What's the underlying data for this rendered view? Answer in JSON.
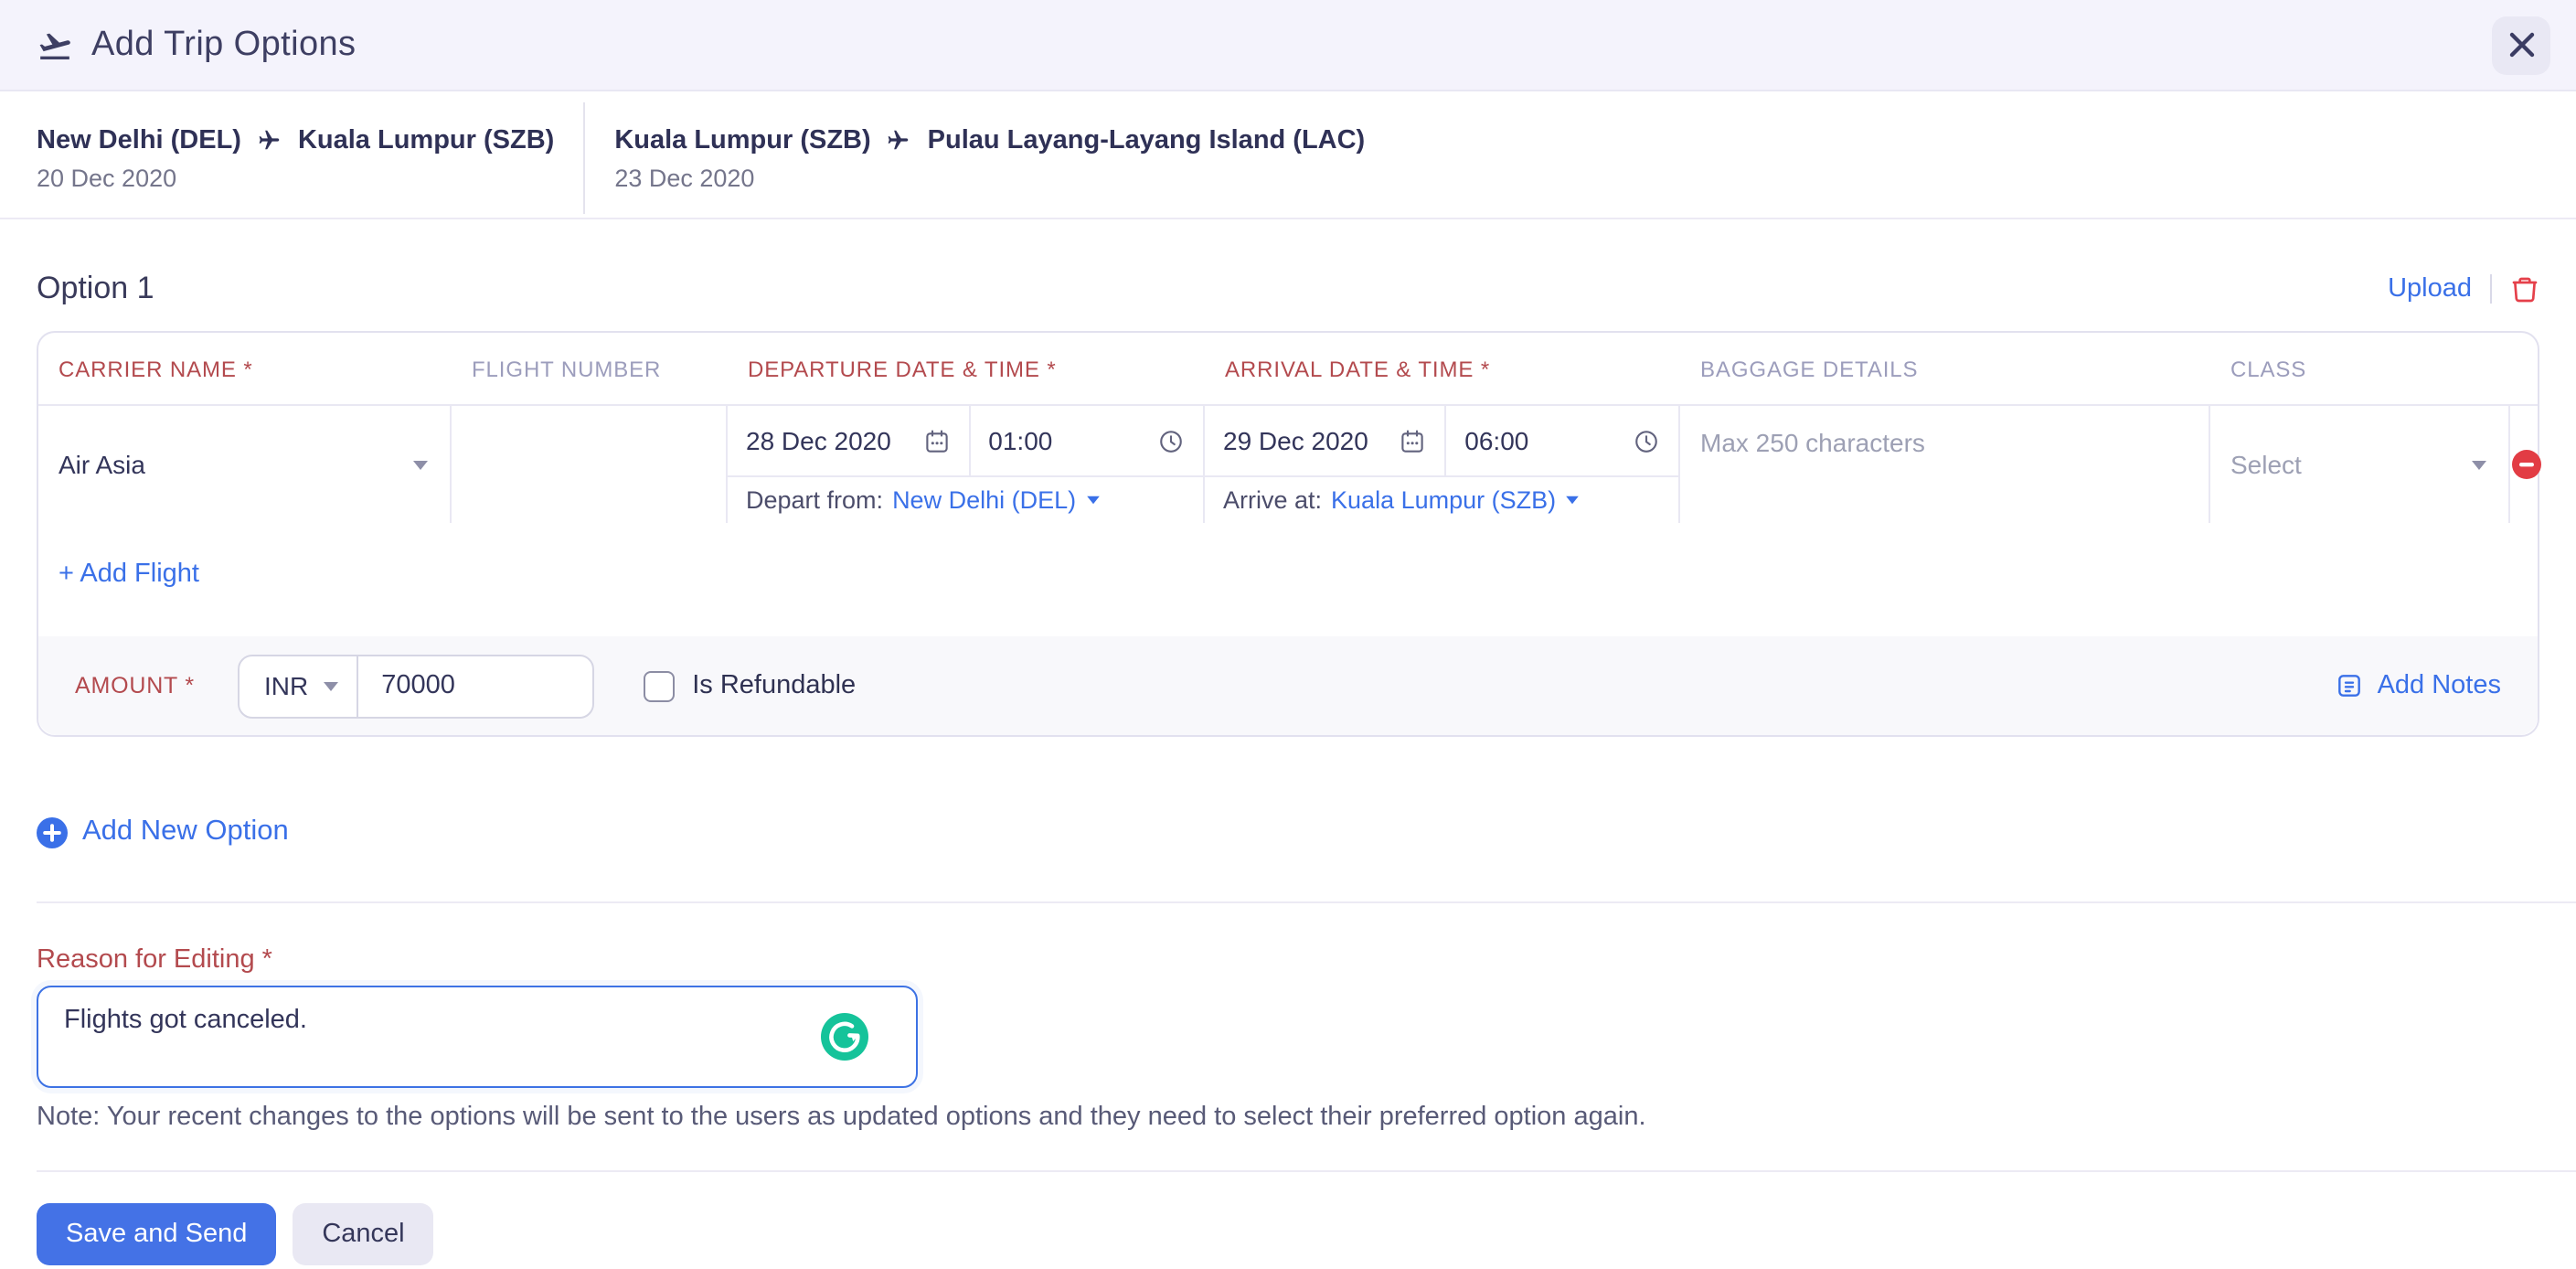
{
  "header": {
    "title": "Add Trip Options"
  },
  "trip_segments": [
    {
      "from": "New Delhi (DEL)",
      "to": "Kuala Lumpur (SZB)",
      "date": "20 Dec 2020"
    },
    {
      "from": "Kuala Lumpur (SZB)",
      "to": "Pulau Layang-Layang Island (LAC)",
      "date": "23 Dec 2020"
    }
  ],
  "option": {
    "title": "Option 1",
    "upload_label": "Upload",
    "table": {
      "columns": [
        {
          "label": "Carrier Name *",
          "required": true
        },
        {
          "label": "Flight Number",
          "required": false
        },
        {
          "label": "Departure Date & Time *",
          "required": true
        },
        {
          "label": "Arrival Date & Time *",
          "required": true
        },
        {
          "label": "Baggage Details",
          "required": false
        },
        {
          "label": "Class",
          "required": false
        }
      ]
    },
    "flight_row": {
      "carrier_value": "Air Asia",
      "flight_number_value": "",
      "departure": {
        "date": "28 Dec 2020",
        "time": "01:00",
        "location_prefix": "Depart from:",
        "location": "New Delhi (DEL)"
      },
      "arrival": {
        "date": "29 Dec 2020",
        "time": "06:00",
        "location_prefix": "Arrive at:",
        "location": "Kuala Lumpur (SZB)"
      },
      "baggage_placeholder": "Max 250 characters",
      "class_placeholder": "Select"
    },
    "add_flight_label": "+ Add Flight",
    "amount": {
      "label": "Amount *",
      "currency": "INR",
      "value": "70000",
      "refundable_label": "Is Refundable",
      "add_notes_label": "Add Notes"
    }
  },
  "add_new_option_label": "Add New Option",
  "reason": {
    "label": "Reason for Editing *",
    "value": "Flights got canceled."
  },
  "note": "Note: Your recent changes to the options will be sent to the users as updated options and they need to select their preferred option again.",
  "footer": {
    "save_label": "Save and Send",
    "cancel_label": "Cancel"
  },
  "colors": {
    "accent_blue": "#3a70e8",
    "required_red": "#b34a4e",
    "danger_red": "#e23c44",
    "grammarly_green": "#15c39a",
    "topbar_bg": "#f4f3fc"
  }
}
